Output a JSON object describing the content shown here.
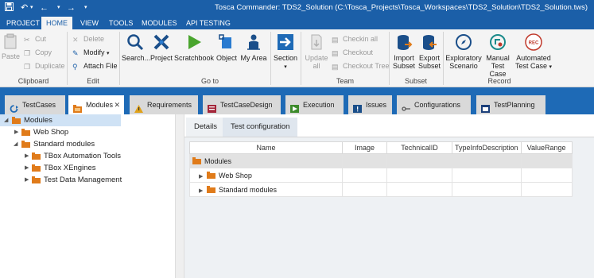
{
  "window": {
    "title": "Tosca Commander: TDS2_Solution (C:\\Tosca_Projects\\Tosca_Workspaces\\TDS2_Solution\\TDS2_Solution.tws)"
  },
  "menu_tabs": [
    "PROJECT",
    "HOME",
    "VIEW",
    "TOOLS",
    "MODULES",
    "API TESTING"
  ],
  "ribbon": {
    "clipboard": {
      "label": "Clipboard",
      "paste": "Paste",
      "cut": "Cut",
      "copy": "Copy",
      "duplicate": "Duplicate"
    },
    "edit": {
      "label": "Edit",
      "delete": "Delete",
      "modify": "Modify",
      "attach_file": "Attach File"
    },
    "goto": {
      "label": "Go to",
      "search": "Search...",
      "project": "Project",
      "scratchbook": "Scratchbook",
      "object": "Object",
      "my_area": "My Area",
      "section": "Section"
    },
    "team": {
      "label": "Team",
      "update_all_1": "Update",
      "update_all_2": "all",
      "checkin_all": "Checkin all",
      "checkout": "Checkout",
      "checkout_tree": "Checkout Tree"
    },
    "subset": {
      "label": "Subset",
      "import_1": "Import",
      "import_2": "Subset",
      "export_1": "Export",
      "export_2": "Subset"
    },
    "record": {
      "label": "Record",
      "exploratory_1": "Exploratory",
      "exploratory_2": "Scenario",
      "manual_1": "Manual",
      "manual_2": "Test Case",
      "automated_1": "Automated",
      "automated_2": "Test Case",
      "rec_badge": "REC"
    }
  },
  "doc_tabs": [
    "TestCases",
    "Modules",
    "Requirements",
    "TestCaseDesign",
    "Execution",
    "Issues",
    "Configurations",
    "TestPlanning"
  ],
  "tree": {
    "root": "Modules",
    "items": [
      "Web Shop",
      "Standard modules",
      "TBox Automation Tools",
      "TBox XEngines",
      "Test Data Management"
    ]
  },
  "detail_tabs": [
    "Details",
    "Test configuration"
  ],
  "grid": {
    "columns": [
      "Name",
      "Image",
      "TechnicalID",
      "TypeInfoDescription",
      "ValueRange"
    ],
    "rows": [
      "Modules",
      "Web Shop",
      "Standard modules"
    ]
  },
  "colors": {
    "brand": "#1b5fa8",
    "doc_tab_bar": "#1e6ab6",
    "folder": "#e07b1a",
    "selection": "#cfe2f5"
  }
}
